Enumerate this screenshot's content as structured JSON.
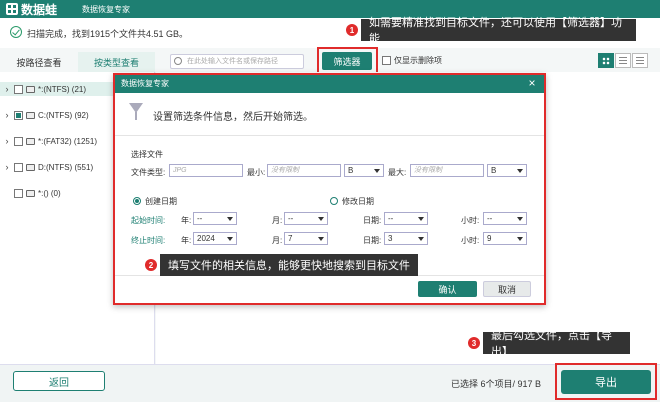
{
  "app": {
    "logo_text": "数据蛙",
    "title": "数据恢复专家"
  },
  "status": {
    "text": "扫描完成，找到1915个文件共4.51 GB。"
  },
  "callouts": [
    {
      "number": "1",
      "text": "如需要精准找到目标文件，还可以使用【筛选器】功能"
    },
    {
      "number": "2",
      "text": "填写文件的相关信息，能够更快地搜索到目标文件"
    },
    {
      "number": "3",
      "text": "最后勾选文件，点击【导出】"
    }
  ],
  "tabs": [
    {
      "label": "按路径查看"
    },
    {
      "label": "按类型查看"
    }
  ],
  "toolbar": {
    "search_placeholder": "在此处输入文件名或保存路径",
    "filter_label": "筛选器",
    "show_deleted_label": "仅显示删除项"
  },
  "tree": [
    {
      "label": "*:(NTFS) (21)",
      "expandable": true
    },
    {
      "label": "C:(NTFS) (92)",
      "expandable": true
    },
    {
      "label": "*:(FAT32) (1251)",
      "expandable": true
    },
    {
      "label": "D:(NTFS) (551)",
      "expandable": true
    },
    {
      "label": "*:() (0)",
      "expandable": false
    }
  ],
  "dialog": {
    "title": "数据恢复专家",
    "close": "×",
    "header": "设置筛选条件信息，然后开始筛选。",
    "section_label": "选择文件",
    "file_type_label": "文件类型:",
    "file_type_placeholder": "JPG",
    "min_label": "最小:",
    "min_placeholder": "没有限制",
    "min_unit": "B",
    "max_label": "最大:",
    "max_placeholder": "没有限制",
    "max_unit": "B",
    "created_label": "创建日期",
    "modified_label": "修改日期",
    "start_label": "起始时间:",
    "end_label": "终止时间:",
    "year_label": "年:",
    "month_label": "月:",
    "day_label": "日期:",
    "hour_label": "小时:",
    "start": {
      "year": "--",
      "month": "--",
      "day": "--",
      "hour": "--"
    },
    "end": {
      "year": "2024",
      "month": "7",
      "day": "3",
      "hour": "9"
    },
    "ok_label": "确认",
    "cancel_label": "取消"
  },
  "footer": {
    "back_label": "返回",
    "selected_text": "已选择 6个项目/ 917  B",
    "export_label": "导出"
  },
  "colors": {
    "accent": "#1e7f72",
    "highlight": "#e02b2b",
    "callout_bg": "#333333"
  }
}
